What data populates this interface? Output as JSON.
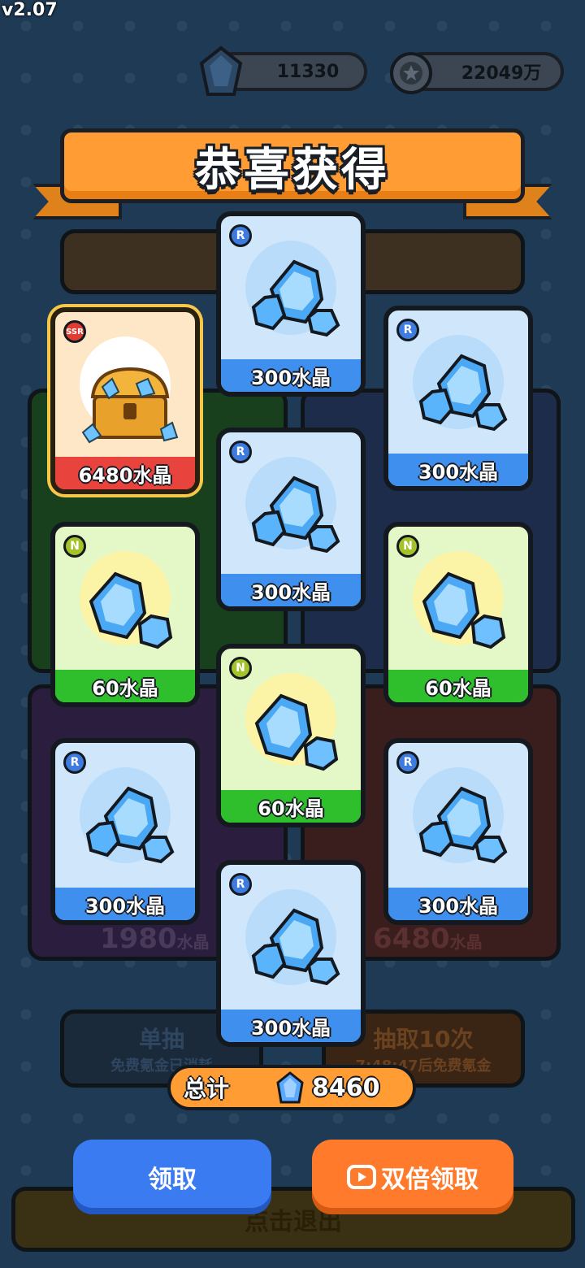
{
  "version": "v2.07",
  "currency": {
    "crystal": "11330",
    "coins": "22049万"
  },
  "banner": {
    "title": "恭喜获得"
  },
  "background": {
    "single_draw": "单抽",
    "single_draw_sub": "免费氪金已消耗",
    "ten_draw": "抽取10次",
    "ten_draw_sub": "7:48:47后免费氪金",
    "exit": "点击退出",
    "left_price": "1980",
    "right_price": "6480",
    "price_unit": "水晶"
  },
  "cards": [
    {
      "rarity": "SSR",
      "label": "6480水晶"
    },
    {
      "rarity": "R",
      "label": "300水晶"
    },
    {
      "rarity": "R",
      "label": "300水晶"
    },
    {
      "rarity": "R",
      "label": "300水晶"
    },
    {
      "rarity": "N",
      "label": "60水晶"
    },
    {
      "rarity": "N",
      "label": "60水晶"
    },
    {
      "rarity": "N",
      "label": "60水晶"
    },
    {
      "rarity": "R",
      "label": "300水晶"
    },
    {
      "rarity": "R",
      "label": "300水晶"
    },
    {
      "rarity": "R",
      "label": "300水晶"
    }
  ],
  "total": {
    "label": "总计",
    "value": "8460"
  },
  "buttons": {
    "claim": "领取",
    "double_claim": "双倍领取"
  }
}
